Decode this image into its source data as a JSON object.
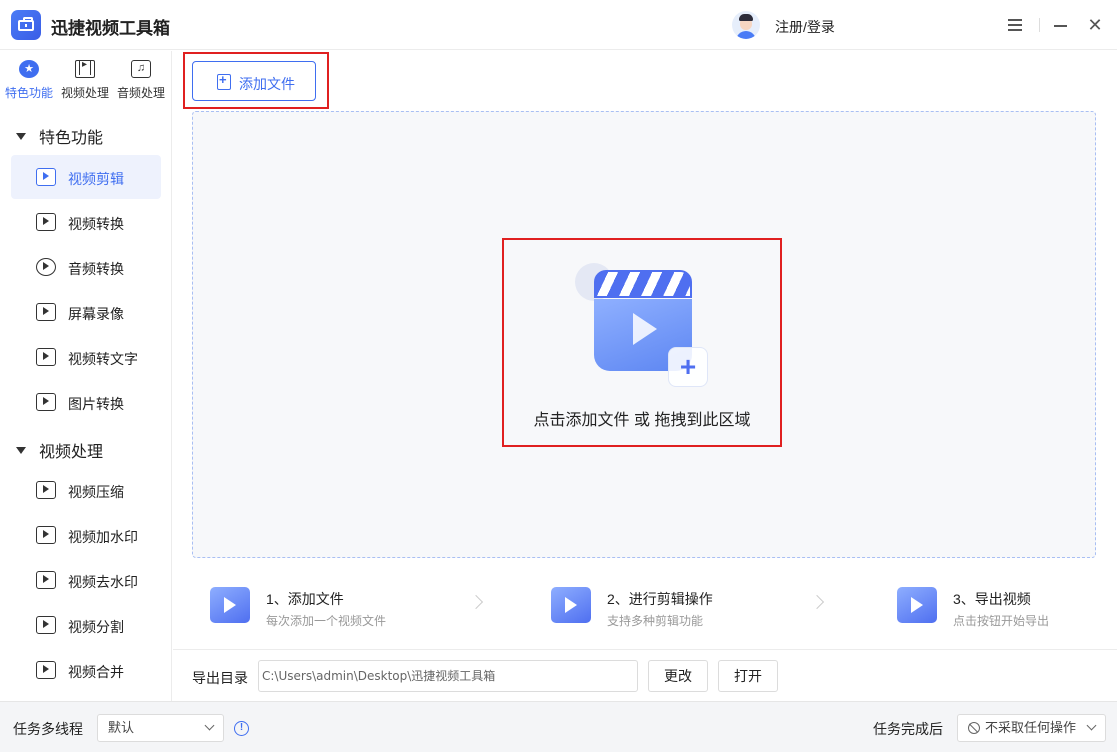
{
  "app": {
    "title": "迅捷视频工具箱",
    "login_label": "注册/登录"
  },
  "top_categories": [
    {
      "label": "特色功能",
      "icon": "star-icon",
      "active": true
    },
    {
      "label": "视频处理",
      "icon": "film-icon",
      "active": false
    },
    {
      "label": "音频处理",
      "icon": "music-icon",
      "active": false
    }
  ],
  "sidebar": {
    "groups": [
      {
        "title": "特色功能",
        "items": [
          {
            "label": "视频剪辑",
            "icon": "video-edit-icon",
            "active": true
          },
          {
            "label": "视频转换",
            "icon": "video-convert-icon"
          },
          {
            "label": "音频转换",
            "icon": "audio-convert-icon"
          },
          {
            "label": "屏幕录像",
            "icon": "screen-record-icon"
          },
          {
            "label": "视频转文字",
            "icon": "video-to-text-icon"
          },
          {
            "label": "图片转换",
            "icon": "image-convert-icon"
          }
        ]
      },
      {
        "title": "视频处理",
        "items": [
          {
            "label": "视频压缩",
            "icon": "video-compress-icon"
          },
          {
            "label": "视频加水印",
            "icon": "add-watermark-icon"
          },
          {
            "label": "视频去水印",
            "icon": "remove-watermark-icon"
          },
          {
            "label": "视频分割",
            "icon": "video-split-icon"
          },
          {
            "label": "视频合并",
            "icon": "video-merge-icon"
          }
        ]
      }
    ]
  },
  "main": {
    "add_file_label": "添加文件",
    "drop_text": "点击添加文件 或 拖拽到此区域",
    "steps": [
      {
        "title": "1、添加文件",
        "desc": "每次添加一个视频文件"
      },
      {
        "title": "2、进行剪辑操作",
        "desc": "支持多种剪辑功能"
      },
      {
        "title": "3、导出视频",
        "desc": "点击按钮开始导出"
      }
    ],
    "output": {
      "label": "导出目录",
      "path": "C:\\Users\\admin\\Desktop\\迅捷视频工具箱",
      "change_label": "更改",
      "open_label": "打开"
    }
  },
  "bottom": {
    "multithread_label": "任务多线程",
    "multithread_value": "默认",
    "after_label": "任务完成后",
    "after_value": "不采取任何操作"
  },
  "colors": {
    "accent": "#3f6ef0",
    "highlight": "#e02020"
  }
}
